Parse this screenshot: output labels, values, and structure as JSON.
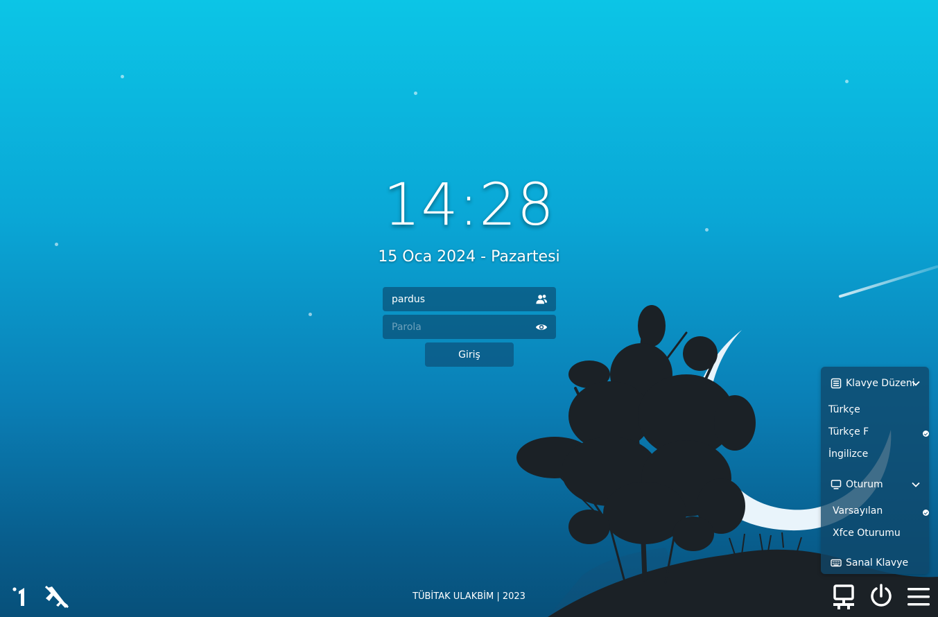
{
  "clock": {
    "time": "14:28",
    "date": "15 Oca 2024 - Pazartesi"
  },
  "login": {
    "username_value": "pardus",
    "password_placeholder": "Parola",
    "submit_label": "Giriş"
  },
  "panel": {
    "keyboard_layout": {
      "title": "Klavye Düzeni",
      "items": [
        {
          "label": "Türkçe",
          "selected": false
        },
        {
          "label": "Türkçe F",
          "selected": true
        },
        {
          "label": "İngilizce",
          "selected": false
        }
      ]
    },
    "session": {
      "title": "Oturum",
      "items": [
        {
          "label": "Varsayılan",
          "selected": true
        },
        {
          "label": "Xfce Oturumu",
          "selected": false
        }
      ]
    },
    "virtual_keyboard_label": "Sanal Klavye"
  },
  "footer": {
    "text": "TÜBİTAK ULAKBİM | 2023"
  },
  "icons": {
    "users": "users-icon",
    "eye": "eye-icon",
    "keyboard_layout": "keyboard-layout-icon",
    "session": "monitor-icon",
    "virtual_keyboard": "keyboard-icon",
    "accessibility": "accessibility-icon",
    "network_off": "network-off-icon",
    "network": "network-icon",
    "power": "power-icon",
    "menu": "menu-icon"
  },
  "colors": {
    "sky_top": "#0cc5e6",
    "sky_bottom": "#07507a",
    "silhouette": "#1b2126",
    "moon": "#e9f4fb"
  }
}
